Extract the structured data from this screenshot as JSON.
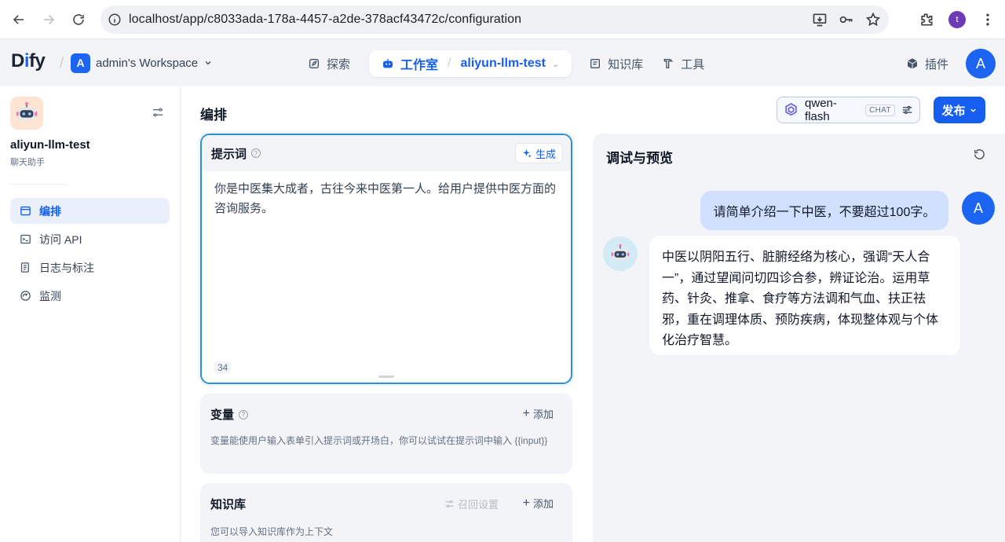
{
  "browser": {
    "url": "localhost/app/c8033ada-178a-4457-a2de-378acf43472c/configuration",
    "profile_initial": "t"
  },
  "header": {
    "logo": "Dify",
    "workspace_initial": "A",
    "workspace_name": "admin's Workspace",
    "nav": {
      "explore": "探索",
      "studio": "工作室",
      "current_app": "aliyun-llm-test",
      "knowledge": "知识库",
      "tools": "工具"
    },
    "plugins": "插件",
    "user_initial": "A"
  },
  "sidebar": {
    "app_name": "aliyun-llm-test",
    "app_type": "聊天助手",
    "items": [
      {
        "label": "编排",
        "icon": "layout-icon"
      },
      {
        "label": "访问 API",
        "icon": "terminal-icon"
      },
      {
        "label": "日志与标注",
        "icon": "log-icon"
      },
      {
        "label": "监测",
        "icon": "monitor-icon"
      }
    ]
  },
  "main": {
    "title": "编排",
    "model": {
      "name": "qwen-flash",
      "badge": "CHAT"
    },
    "publish_label": "发布",
    "prompt": {
      "label": "提示词",
      "generate_label": "生成",
      "text": "你是中医集大成者，古往今来中医第一人。给用户提供中医方面的咨询服务。",
      "char_count": "34"
    },
    "variables": {
      "label": "变量",
      "add_label": "添加",
      "desc": "变量能使用户输入表单引入提示词或开场白，你可以试试在提示词中输入 {{input}}"
    },
    "knowledge": {
      "label": "知识库",
      "recall_label": "召回设置",
      "add_label": "添加",
      "desc": "您可以导入知识库作为上下文"
    }
  },
  "debug": {
    "title": "调试与预览",
    "user_message": "请简单介绍一下中医，不要超过100字。",
    "user_initial": "A",
    "bot_message": "中医以阴阳五行、脏腑经络为核心，强调“天人合一”，通过望闻问切四诊合参，辨证论治。运用草药、针灸、推拿、食疗等方法调和气血、扶正祛邪，重在调理体质、预防疾病，体现整体观与个体化治疗智慧。"
  },
  "colors": {
    "accent": "#155eef",
    "prompt_border": "#2e90d6",
    "user_bubble": "#d1e0ff",
    "panel_bg": "#f2f4f7"
  }
}
